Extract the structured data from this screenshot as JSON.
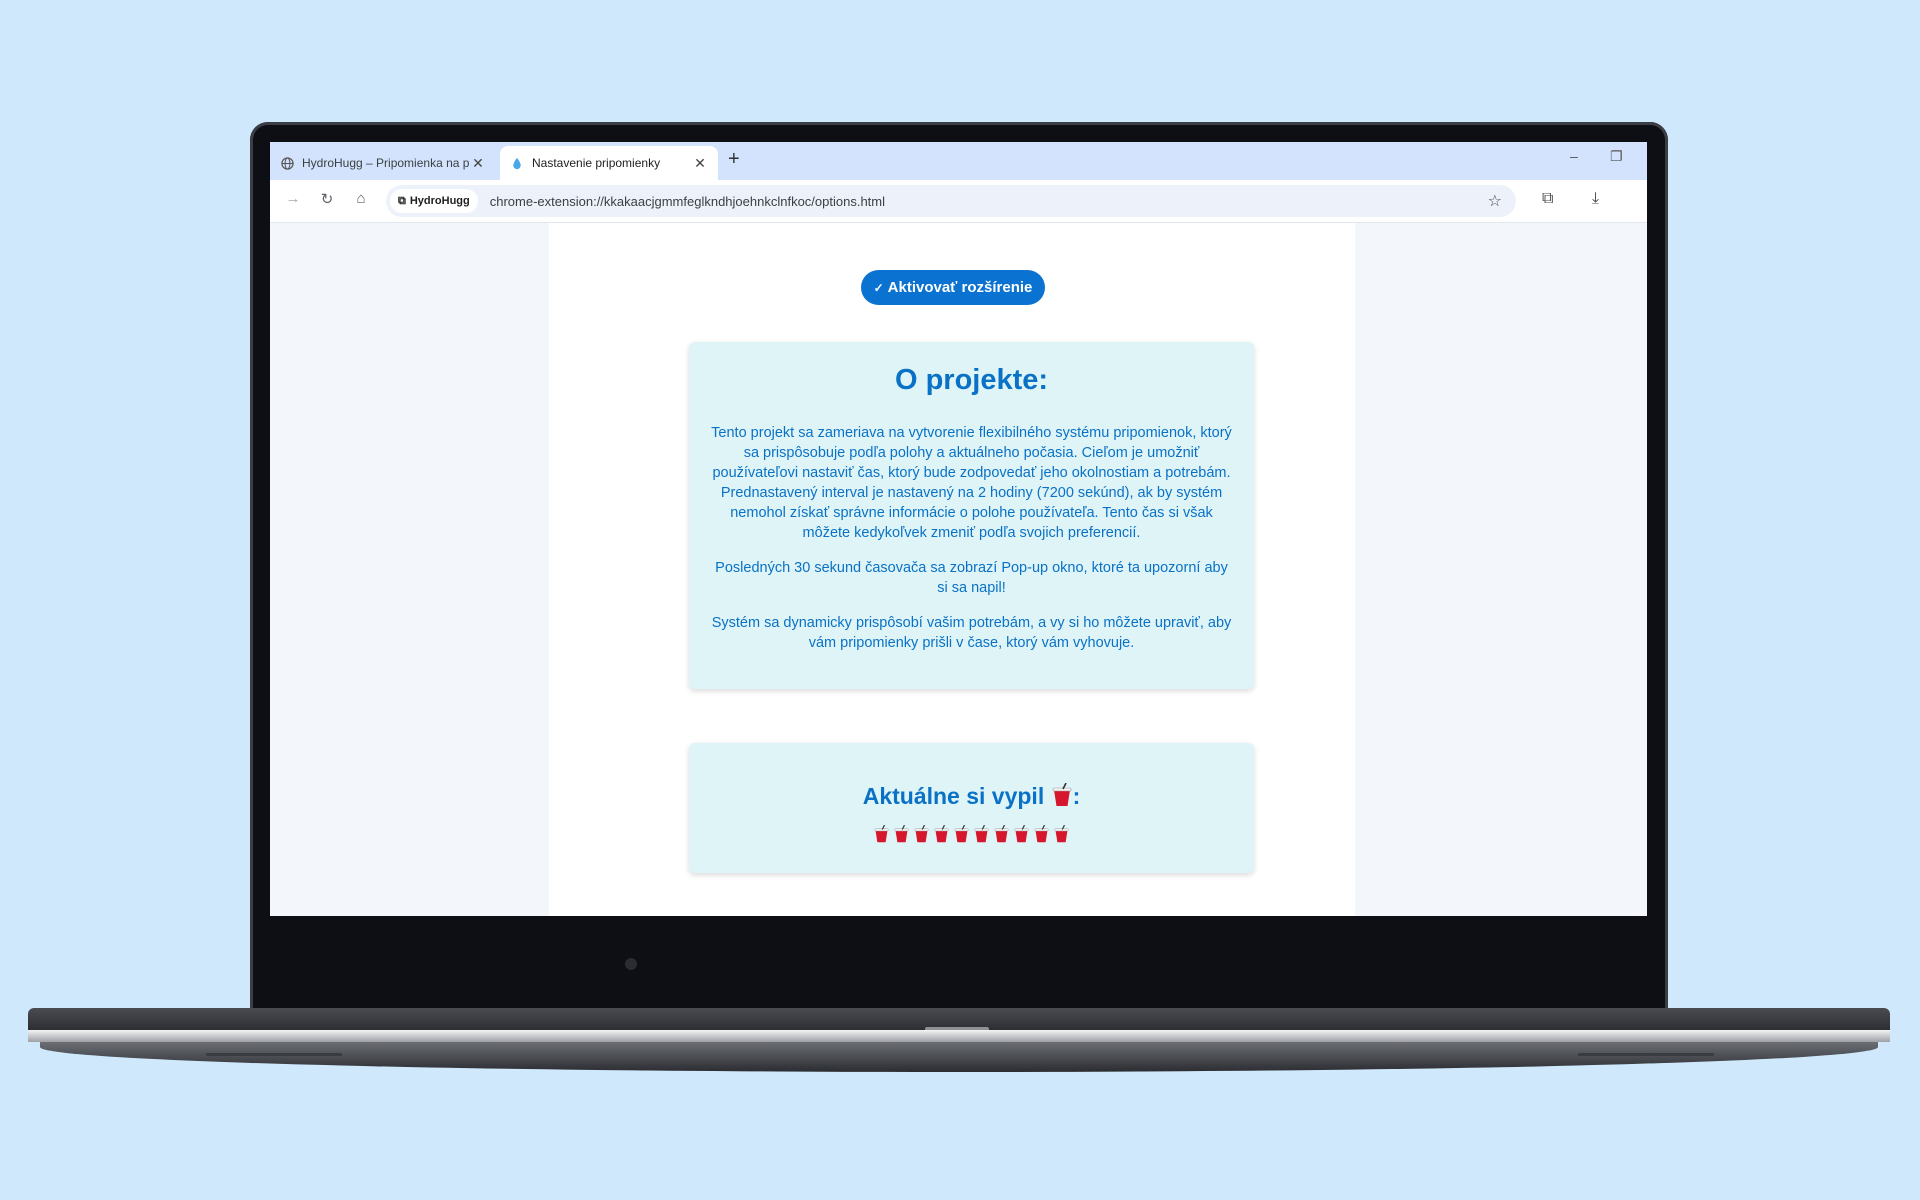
{
  "browser": {
    "tabs": [
      {
        "title": "HydroHugg – Pripomienka na p",
        "active": false,
        "icon": "globe-icon"
      },
      {
        "title": "Nastavenie pripomienky",
        "active": true,
        "icon": "water-drop-icon"
      }
    ],
    "new_tab_label": "+",
    "address_bar": {
      "chip_label": "HydroHugg",
      "url": "chrome-extension://kkakaacjgmmfeglkndhjoehnkclnfkoc/options.html"
    }
  },
  "page": {
    "activate_button": "Aktivovať rozšírenie",
    "activate_check": "✓",
    "about": {
      "title": "O projekte:",
      "paragraphs": [
        "Tento projekt sa zameriava na vytvorenie flexibilného systému pripomienok, ktorý sa prispôsobuje podľa polohy a aktuálneho počasia. Cieľom je umožniť používateľovi nastaviť čas, ktorý bude zodpovedať jeho okolnostiam a potrebám. Prednastavený interval je nastavený na 2 hodiny (7200 sekúnd), ak by systém nemohol získať správne informácie o polohe používateľa. Tento čas si však môžete kedykoľvek zmeniť podľa svojich preferencií.",
        "Posledných 30 sekund časovača sa zobrazí Pop-up okno, ktoré ta upozorní aby si sa napil!",
        "Systém sa dynamicky prispôsobí vašim potrebám, a vy si ho môžete upraviť, aby vám pripomienky prišli v čase, ktorý vám vyhovuje."
      ]
    },
    "intake": {
      "title": "Aktuálne si vypil",
      "title_suffix": ":",
      "cup_count": 10,
      "cup_icon": "cup-with-straw-icon"
    }
  },
  "colors": {
    "accent": "#0a72d1",
    "text_blue": "#0a72c6",
    "card_bg": "#dff4f7",
    "background": "#cfe8fc"
  }
}
